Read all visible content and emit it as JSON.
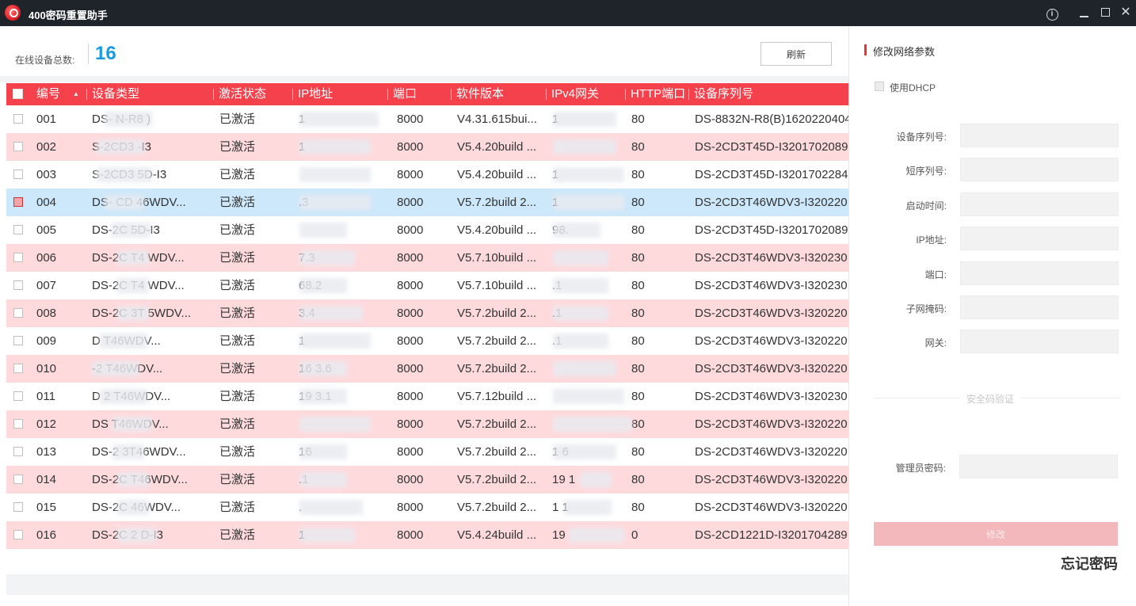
{
  "window": {
    "title": "400密码重置助手",
    "icons": [
      "app-logo",
      "info-icon",
      "minimize-icon",
      "maximize-icon",
      "close-icon"
    ]
  },
  "summary": {
    "count_label": "在线设备总数:",
    "count_value": "16",
    "refresh_label": "刷新"
  },
  "table": {
    "columns": [
      "编号",
      "设备类型",
      "激活状态",
      "IP地址",
      "端口",
      "软件版本",
      "IPv4网关",
      "HTTP端口",
      "设备序列号"
    ],
    "rows": [
      {
        "no": "001",
        "type": "DS-      N-R8  )",
        "status": "已激活",
        "ip": "1",
        "port": "8000",
        "version": "V4.31.615bui...",
        "gateway": "1",
        "http": "80",
        "serial": "DS-8832N-R8(B)1620220404"
      },
      {
        "no": "002",
        "type": "   S-2CD3     -I3",
        "status": "已激活",
        "ip": "1",
        "port": "8000",
        "version": "V5.4.20build ...",
        "gateway": "",
        "http": "80",
        "serial": "DS-2CD3T45D-I3201702089"
      },
      {
        "no": "003",
        "type": "    S-2CD3     5D-I3",
        "status": "已激活",
        "ip": "",
        "port": "8000",
        "version": "V5.4.20build ...",
        "gateway": "1",
        "http": "80",
        "serial": "DS-2CD3T45D-I3201702284"
      },
      {
        "no": "004",
        "type": "DS-   CD   46WDV...",
        "status": "已激活",
        "ip": "   .3",
        "port": "8000",
        "version": "V5.7.2build 2...",
        "gateway": "1",
        "http": "80",
        "serial": "DS-2CD3T46WDV3-I320220"
      },
      {
        "no": "005",
        "type": "DS-2C       5D-I3",
        "status": "已激活",
        "ip": "",
        "port": "8000",
        "version": "V5.4.20build ...",
        "gateway": "   98.",
        "http": "80",
        "serial": "DS-2CD3T45D-I3201702089"
      },
      {
        "no": "006",
        "type": "DS-2C    T4   WDV...",
        "status": "已激活",
        "ip": "   7.3",
        "port": "8000",
        "version": "V5.7.10build ...",
        "gateway": "",
        "http": "80",
        "serial": "DS-2CD3T46WDV3-I320230"
      },
      {
        "no": "007",
        "type": "DS-2C    T4   WDV...",
        "status": "已激活",
        "ip": "   68.2",
        "port": "8000",
        "version": "V5.7.10build ...",
        "gateway": "   .1",
        "http": "80",
        "serial": "DS-2CD3T46WDV3-I320230"
      },
      {
        "no": "008",
        "type": "DS-2C    3T   5WDV...",
        "status": "已激活",
        "ip": "   3.4",
        "port": "8000",
        "version": "V5.7.2build 2...",
        "gateway": "   .1",
        "http": "80",
        "serial": "DS-2CD3T46WDV3-I320220"
      },
      {
        "no": "009",
        "type": "D      T46WDV...",
        "status": "已激活",
        "ip": "1",
        "port": "8000",
        "version": "V5.7.2build 2...",
        "gateway": "   .1",
        "http": "80",
        "serial": "DS-2CD3T46WDV3-I320220"
      },
      {
        "no": "010",
        "type": "    -2     T46WDV...",
        "status": "已激活",
        "ip": "   16   3.6",
        "port": "8000",
        "version": "V5.7.2build 2...",
        "gateway": "",
        "http": "80",
        "serial": "DS-2CD3T46WDV3-I320220"
      },
      {
        "no": "011",
        "type": "D   2     T46WDV...",
        "status": "已激活",
        "ip": "19   3.1",
        "port": "8000",
        "version": "V5.7.12build ...",
        "gateway": "",
        "http": "80",
        "serial": "DS-2CD3T46WDV3-I320230"
      },
      {
        "no": "012",
        "type": "DS        T46WDV...",
        "status": "已激活",
        "ip": "",
        "port": "8000",
        "version": "V5.7.2build 2...",
        "gateway": "",
        "http": "80",
        "serial": "DS-2CD3T46WDV3-I320220"
      },
      {
        "no": "013",
        "type": "DS-2    3T46WDV...",
        "status": "已激活",
        "ip": "   16",
        "port": "8000",
        "version": "V5.7.2build 2...",
        "gateway": "1   6",
        "http": "80",
        "serial": "DS-2CD3T46WDV3-I320220"
      },
      {
        "no": "014",
        "type": "DS-2C      T46WDV...",
        "status": "已激活",
        "ip": "   .1",
        "port": "8000",
        "version": "V5.7.2build 2...",
        "gateway": "19   1",
        "http": "80",
        "serial": "DS-2CD3T46WDV3-I320220"
      },
      {
        "no": "015",
        "type": "DS-2C    46WDV...",
        "status": "已激活",
        "ip": "   .",
        "port": "8000",
        "version": "V5.7.2build 2...",
        "gateway": "1   1",
        "http": "80",
        "serial": "DS-2CD3T46WDV3-I320220"
      },
      {
        "no": "016",
        "type": "DS-2C    2     D-I3",
        "status": "已激活",
        "ip": "1",
        "port": "8000",
        "version": "V5.4.24build ...",
        "gateway": "19",
        "http": "0",
        "serial": "DS-2CD1221D-I3201704289"
      }
    ]
  },
  "panel": {
    "title": "修改网络参数",
    "dhcp_label": "使用DHCP",
    "fields": [
      {
        "label": "设备序列号:",
        "value": ""
      },
      {
        "label": "短序列号:",
        "value": ""
      },
      {
        "label": "启动时间:",
        "value": ""
      },
      {
        "label": "IP地址:",
        "value": ""
      },
      {
        "label": "端口:",
        "value": ""
      },
      {
        "label": "子网掩码:",
        "value": ""
      },
      {
        "label": "网关:",
        "value": ""
      }
    ],
    "security_label": "安全码验证",
    "admin_password_label": "管理员密码:",
    "admin_password_value": "",
    "modify_label": "修改",
    "forgot_label": "忘记密码"
  },
  "colors": {
    "accent": "#f4414b",
    "row_alt": "#ffdadd",
    "row_selected": "#cde8fb",
    "count": "#1a9ae0",
    "titlebar": "#1e2429"
  }
}
